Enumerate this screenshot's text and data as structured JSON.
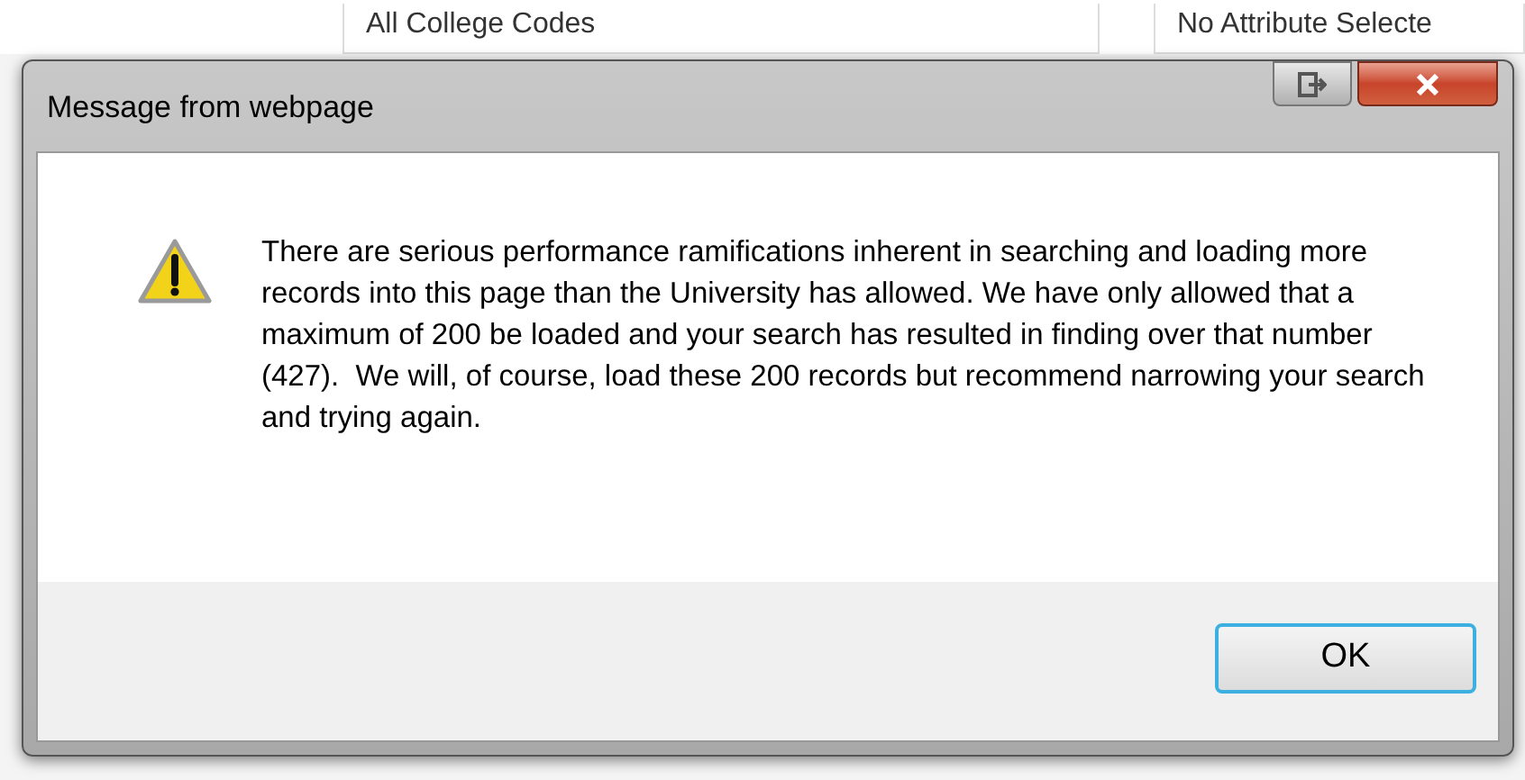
{
  "background_fields": [
    "All College Codes",
    "No Attribute Selecte"
  ],
  "dialog": {
    "title": "Message from webpage",
    "message": "There are serious performance ramifications inherent in searching and loading more records into this page than the University has allowed. We have only allowed that a maximum of 200 be loaded and your search has resulted in finding over that number (427).  We will, of course, load these 200 records but recommend narrowing your search and trying again.",
    "buttons": [
      "OK"
    ]
  }
}
